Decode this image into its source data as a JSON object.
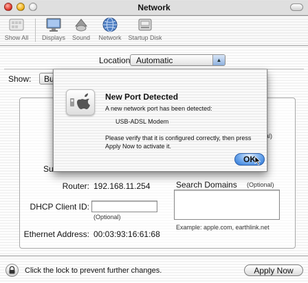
{
  "window": {
    "title": "Network"
  },
  "toolbar": {
    "items": [
      {
        "label": "Show All",
        "icon": "show-all-icon"
      },
      {
        "label": "Displays",
        "icon": "displays-icon"
      },
      {
        "label": "Sound",
        "icon": "sound-icon"
      },
      {
        "label": "Network",
        "icon": "network-icon"
      },
      {
        "label": "Startup Disk",
        "icon": "startup-disk-icon"
      }
    ]
  },
  "location": {
    "label": "Location:",
    "value": "Automatic"
  },
  "show": {
    "label": "Show:",
    "value_partial": "Bu"
  },
  "tcpip": {
    "router_label": "Router:",
    "router_value": "192.168.11.254",
    "dhcp_label": "DHCP Client ID:",
    "dhcp_value": "",
    "dhcp_hint": "(Optional)",
    "ethernet_label": "Ethernet Address:",
    "ethernet_value": "00:03:93:16:61:68",
    "search_domains_label": "Search Domains",
    "search_domains_hint": "(Optional)",
    "search_domains_example": "Example: apple.com, earthlink.net",
    "partial_optional_top": "onal)",
    "partial_left_label": "Su"
  },
  "footer": {
    "lock_text": "Click the lock to prevent further changes.",
    "apply_label": "Apply Now"
  },
  "dialog": {
    "title": "New Port Detected",
    "line1": "A new network port has been detected:",
    "port_name": "USB-ADSL Modem",
    "line3": "Please verify that it is configured correctly, then press Apply Now to activate it.",
    "ok_label": "OK"
  },
  "colors": {
    "default_button": "#5b9be6"
  }
}
